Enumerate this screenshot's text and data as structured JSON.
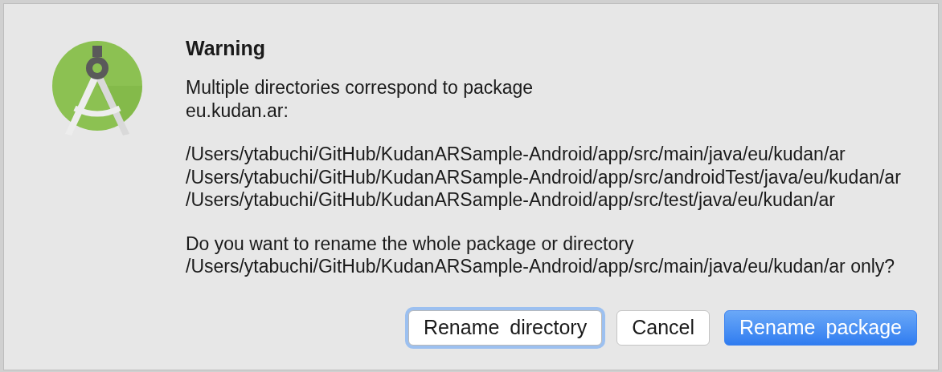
{
  "dialog": {
    "title": "Warning",
    "paragraphs": [
      [
        "Multiple directories correspond to package",
        "eu.kudan.ar:"
      ],
      [
        "/Users/ytabuchi/GitHub/KudanARSample-Android/app/src/main/java/eu/kudan/ar",
        "/Users/ytabuchi/GitHub/KudanARSample-Android/app/src/androidTest/java/eu/kudan/ar",
        "/Users/ytabuchi/GitHub/KudanARSample-Android/app/src/test/java/eu/kudan/ar"
      ],
      [
        "Do you want to rename the whole package or directory",
        "/Users/ytabuchi/GitHub/KudanARSample-Android/app/src/main/java/eu/kudan/ar only?"
      ]
    ],
    "buttons": [
      {
        "label": "Rename directory",
        "kind": "focused"
      },
      {
        "label": "Cancel",
        "kind": "plain"
      },
      {
        "label": "Rename package",
        "kind": "default"
      }
    ]
  }
}
